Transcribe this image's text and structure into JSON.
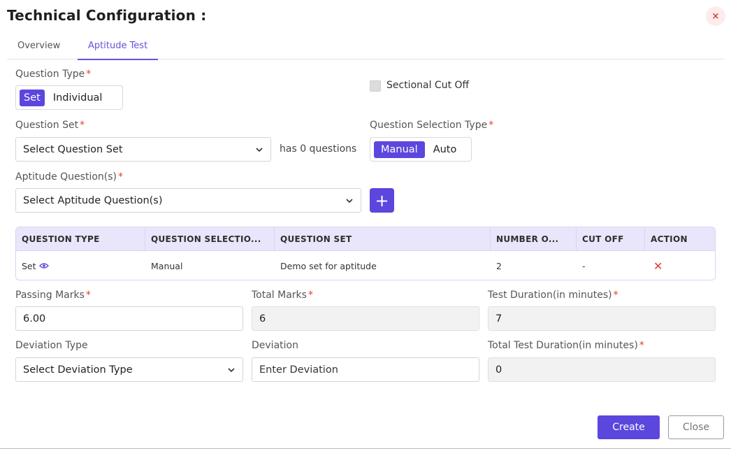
{
  "header": {
    "title": "Technical Configuration :",
    "close_icon": "×"
  },
  "tabs": [
    {
      "label": "Overview",
      "active": false
    },
    {
      "label": "Aptitude Test",
      "active": true
    }
  ],
  "question_type": {
    "label": "Question Type",
    "required": "*",
    "options": [
      "Set",
      "Individual"
    ],
    "selected": "Set"
  },
  "sectional_cutoff": {
    "label": "Sectional Cut Off",
    "checked": false
  },
  "question_set": {
    "label": "Question Set",
    "required": "*",
    "value": "Select Question Set",
    "count_text": "has 0 questions"
  },
  "question_selection_type": {
    "label": "Question Selection Type",
    "required": "*",
    "options": [
      "Manual",
      "Auto"
    ],
    "selected": "Manual"
  },
  "aptitude_questions": {
    "label": "Aptitude Question(s)",
    "required": "*",
    "value": "Select Aptitude Question(s)",
    "add_label": "+"
  },
  "table": {
    "headers": [
      "QUESTION TYPE",
      "QUESTION SELECTIO...",
      "QUESTION SET",
      "NUMBER O...",
      "CUT OFF",
      "ACTION"
    ],
    "rows": [
      {
        "type": "Set",
        "selection": "Manual",
        "set": "Demo set for aptitude",
        "number": "2",
        "cutoff": "-",
        "action": "✕"
      }
    ]
  },
  "passing_marks": {
    "label": "Passing Marks",
    "required": "*",
    "value": "6.00"
  },
  "total_marks": {
    "label": "Total Marks",
    "required": "*",
    "value": "6"
  },
  "test_duration": {
    "label": "Test Duration(in minutes)",
    "required": "*",
    "value": "7"
  },
  "deviation_type": {
    "label": "Deviation Type",
    "value": "Select Deviation Type"
  },
  "deviation": {
    "label": "Deviation",
    "placeholder": "Enter Deviation"
  },
  "total_test_duration": {
    "label": "Total Test Duration(in minutes)",
    "required": "*",
    "value": "0"
  },
  "footer": {
    "create_label": "Create",
    "close_label": "Close"
  },
  "colors": {
    "accent": "#5b46de",
    "danger": "#e53935",
    "table_header_bg": "#e9e6fb"
  }
}
